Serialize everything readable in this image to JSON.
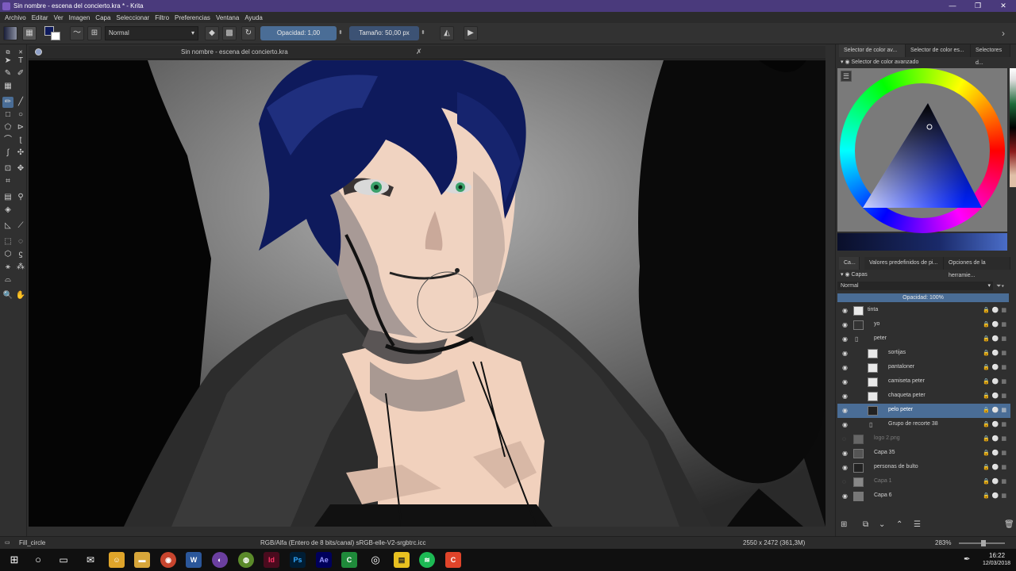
{
  "window": {
    "title": "Sin nombre - escena del concierto.kra * - Krita",
    "controls": [
      "—",
      "❐",
      "✕"
    ]
  },
  "menu": [
    "Archivo",
    "Editar",
    "Ver",
    "Imagen",
    "Capa",
    "Seleccionar",
    "Filtro",
    "Preferencias",
    "Ventana",
    "Ayuda"
  ],
  "toolbar": {
    "blend_mode": "Normal",
    "opacity_label": "Opacidad:  1,00",
    "size_label": "Tamaño:  50,00 px"
  },
  "document": {
    "tab_title": "Sin nombre - escena del concierto.kra"
  },
  "right_dock": {
    "top_tabs": [
      "Selector de color av...",
      "Selector de color es...",
      "Selectores d..."
    ],
    "color_panel_title": "Selector de color avanzado",
    "mid_tabs": [
      "Ca...",
      "Valores predefinidos de pi...",
      "Opciones de la herramie..."
    ],
    "layers_title": "Capas",
    "layer_blend": "Normal",
    "layer_opacity": "Opacidad:  100%",
    "layers": [
      {
        "name": "tinta",
        "visible": true,
        "dim": false
      },
      {
        "name": "yo",
        "visible": true,
        "dim": false
      },
      {
        "name": "peter",
        "visible": true,
        "dim": false
      },
      {
        "name": "sortijas",
        "visible": true,
        "dim": false
      },
      {
        "name": "pantaloner",
        "visible": true,
        "dim": false
      },
      {
        "name": "camiseta peter",
        "visible": true,
        "dim": false
      },
      {
        "name": "chaqueta peter",
        "visible": true,
        "dim": false
      },
      {
        "name": "pelo peter",
        "visible": true,
        "dim": false,
        "selected": true
      },
      {
        "name": "Grupo de recorte 38",
        "visible": true,
        "dim": false
      },
      {
        "name": "logo 2.png",
        "visible": false,
        "dim": true
      },
      {
        "name": "Capa 35",
        "visible": true,
        "dim": false
      },
      {
        "name": "personas de bulto",
        "visible": true,
        "dim": false
      },
      {
        "name": "Capa 1",
        "visible": false,
        "dim": true
      },
      {
        "name": "Capa 6",
        "visible": true,
        "dim": false
      }
    ]
  },
  "status": {
    "tool": "Fill_circle",
    "colorspace": "RGB/Alfa (Entero de 8 bits/canal)  sRGB-elle-V2-srgbtrc.icc",
    "dimensions": "2550 x 2472 (361,3M)",
    "zoom": "283%"
  },
  "taskbar": {
    "time": "16:22",
    "date": "12/03/2018"
  },
  "colors": {
    "titlebar": "#4a3a7c",
    "accent": "#4a6d96",
    "hair": "#0e1a5c"
  }
}
